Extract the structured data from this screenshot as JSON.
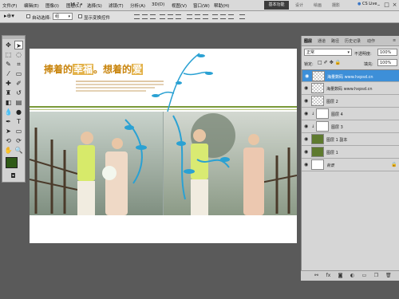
{
  "app": {
    "zoom": "16.7",
    "menu": [
      "文件(F)",
      "编辑(E)",
      "图像(I)",
      "图层(L)",
      "选择(S)",
      "滤镜(T)",
      "分析(A)",
      "3D(D)",
      "视图(V)",
      "窗口(W)",
      "帮助(H)"
    ],
    "workspaces": [
      "基本功能",
      "设计",
      "绘画",
      "摄影"
    ],
    "cs_live": "CS Live",
    "win_controls": [
      "–",
      "□",
      "×"
    ]
  },
  "options_bar": {
    "auto_select_label": "自动选择:",
    "auto_select_value": "组",
    "show_transform_label": "显示变换控件"
  },
  "document": {
    "headline_left": "捧着的",
    "headline_hl1": "幸福",
    "headline_mid": "。想着的",
    "headline_hl2": "爱",
    "colors": {
      "headline": "#c9850e",
      "highlight_bg": "#e3b24a",
      "vine": "#2aa1d3"
    }
  },
  "layers_panel": {
    "tabs": [
      "图层",
      "通道",
      "路径",
      "历史记录",
      "动作"
    ],
    "blend_mode": "正常",
    "opacity_label": "不透明度:",
    "opacity_value": "100%",
    "lock_label": "锁定:",
    "fill_label": "填充:",
    "fill_value": "100%",
    "layers": [
      {
        "name": "海量数码 www.hxpsd.cn",
        "selected": true
      },
      {
        "name": "海量数码 www.hxpsd.cn",
        "selected": false
      },
      {
        "name": "图层 2",
        "selected": false
      },
      {
        "name": "图层 4",
        "selected": false
      },
      {
        "name": "图层 3",
        "selected": false
      },
      {
        "name": "图层 1 副本",
        "selected": false
      },
      {
        "name": "图层 1",
        "selected": false
      },
      {
        "name": "背景",
        "selected": false
      }
    ],
    "bottom_icons": [
      "link-icon",
      "fx-icon",
      "mask-icon",
      "adjust-icon",
      "folder-icon",
      "new-layer-icon",
      "trash-icon"
    ]
  }
}
